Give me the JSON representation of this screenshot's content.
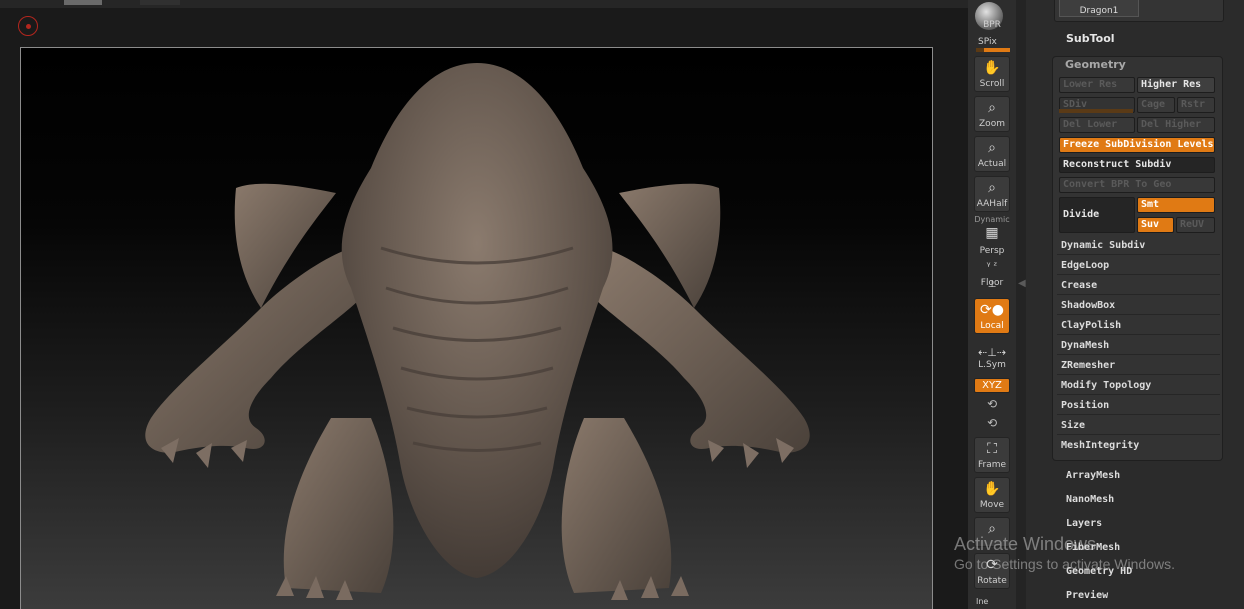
{
  "toolbar": {
    "bpr": "BPR",
    "spix": "SPix",
    "scroll": "Scroll",
    "zoom": "Zoom",
    "actual": "Actual",
    "aahalf": "AAHalf",
    "dynamic": "Dynamic",
    "persp": "Persp",
    "floor": "Floor",
    "local": "Local",
    "lsym": "L.Sym",
    "xyz": "XYZ",
    "frame": "Frame",
    "move": "Move",
    "rotate": "Rotate",
    "inedit": "Ine"
  },
  "subtool": {
    "current_name": "Dragon1",
    "header": "SubTool"
  },
  "geometry": {
    "title": "Geometry",
    "lower_res": "Lower Res",
    "higher_res": "Higher Res",
    "sdiv": "SDiv",
    "cage": "Cage",
    "rstr": "Rstr",
    "del_lower": "Del Lower",
    "del_higher": "Del Higher",
    "freeze": "Freeze SubDivision Levels",
    "reconstruct": "Reconstruct Subdiv",
    "convert_bpr": "Convert BPR To Geo",
    "divide": "Divide",
    "smt": "Smt",
    "suv": "Suv",
    "reuv": "ReUV",
    "items": [
      "Dynamic Subdiv",
      "EdgeLoop",
      "Crease",
      "ShadowBox",
      "ClayPolish",
      "DynaMesh",
      "ZRemesher",
      "Modify Topology",
      "Position",
      "Size",
      "MeshIntegrity"
    ]
  },
  "subpalettes": [
    "ArrayMesh",
    "NanoMesh",
    "Layers",
    "FiberMesh",
    "Geometry HD",
    "Preview"
  ],
  "watermark": {
    "title": "Activate Windows",
    "subtitle": "Go to Settings to activate Windows."
  },
  "colors": {
    "accent": "#e07a14",
    "clay": "#6b5e54"
  }
}
